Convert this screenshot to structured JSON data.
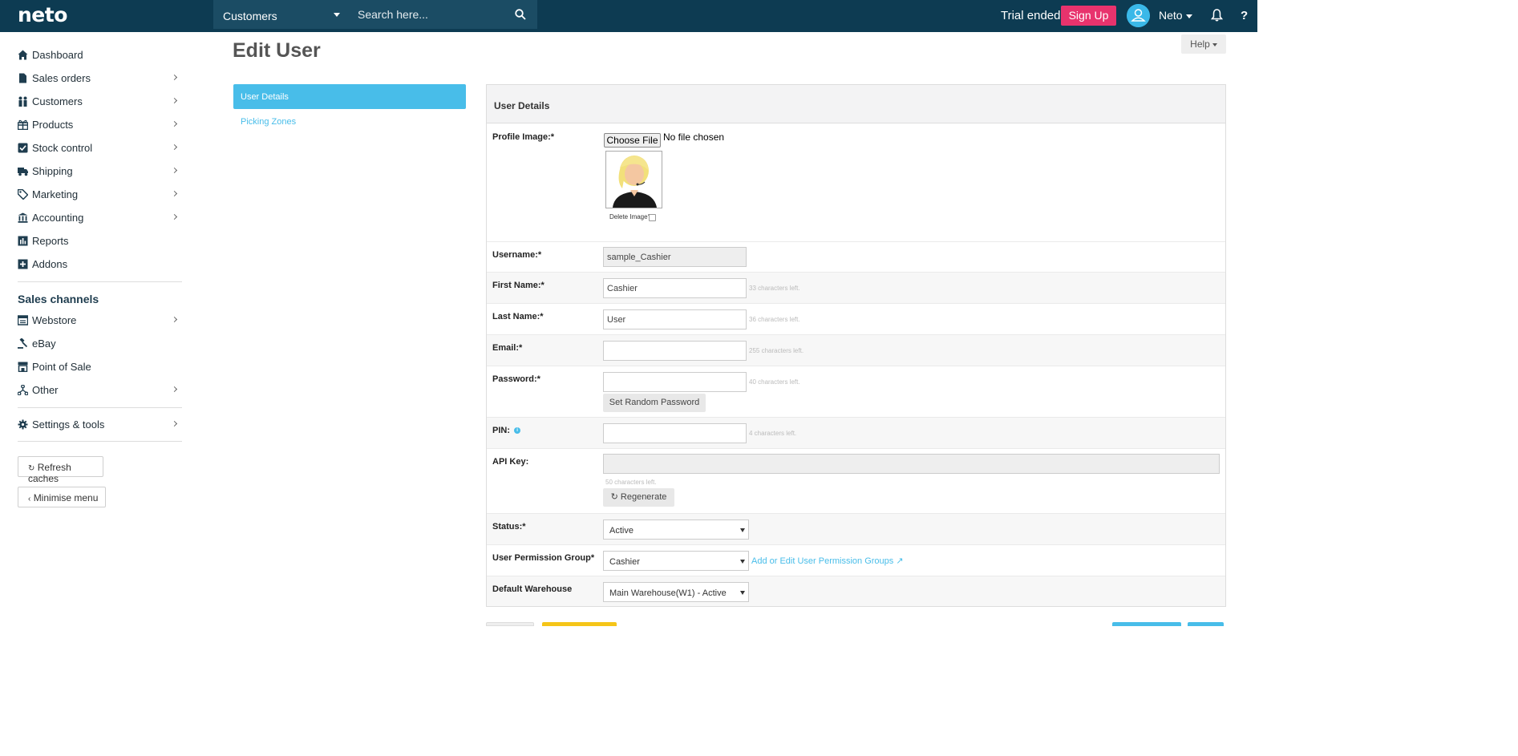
{
  "topbar": {
    "logo": "neto",
    "search_scope": "Customers",
    "search_placeholder": "Search here...",
    "trial_text": "Trial ended.",
    "signup_label": "Sign Up",
    "user_name": "Neto"
  },
  "sidebar": {
    "items": [
      {
        "label": "Dashboard",
        "icon": "home-icon"
      },
      {
        "label": "Sales orders",
        "icon": "document-icon"
      },
      {
        "label": "Customers",
        "icon": "people-icon"
      },
      {
        "label": "Products",
        "icon": "gift-icon"
      },
      {
        "label": "Stock control",
        "icon": "check-square-icon"
      },
      {
        "label": "Shipping",
        "icon": "truck-icon"
      },
      {
        "label": "Marketing",
        "icon": "tag-icon"
      },
      {
        "label": "Accounting",
        "icon": "bank-icon"
      },
      {
        "label": "Reports",
        "icon": "bar-chart-icon"
      },
      {
        "label": "Addons",
        "icon": "plus-square-icon"
      }
    ],
    "channels_heading": "Sales channels",
    "channels": [
      {
        "label": "Webstore",
        "icon": "webstore-icon"
      },
      {
        "label": "eBay",
        "icon": "gavel-icon"
      },
      {
        "label": "Point of Sale",
        "icon": "store-icon"
      },
      {
        "label": "Other",
        "icon": "fork-icon"
      }
    ],
    "settings_label": "Settings & tools",
    "refresh_label": "Refresh caches",
    "minimise_label": "Minimise menu"
  },
  "page": {
    "title": "Edit User",
    "help_label": "Help",
    "subnav": {
      "active": "User Details",
      "link": "Picking Zones"
    }
  },
  "panel": {
    "heading": "User Details",
    "profile_label": "Profile Image:*",
    "choose_file_label": "Choose File",
    "no_file_text": "No file chosen",
    "delete_image_label": "Delete Image?",
    "username_label": "Username:*",
    "username_value": "sample_Cashier",
    "firstname_label": "First Name:*",
    "firstname_value": "Cashier",
    "firstname_hint": "33 characters left.",
    "lastname_label": "Last Name:*",
    "lastname_value": "User",
    "lastname_hint": "36 characters left.",
    "email_label": "Email:*",
    "email_value": "",
    "email_hint": "255 characters left.",
    "password_label": "Password:*",
    "password_value": "",
    "password_hint": "40 characters left.",
    "random_password_label": "Set Random Password",
    "pin_label": "PIN:",
    "pin_value": "",
    "pin_hint": "4 characters left.",
    "apikey_label": "API Key:",
    "apikey_value": "",
    "apikey_hint": "50 characters left.",
    "regenerate_label": "Regenerate",
    "status_label": "Status:*",
    "status_value": "Active",
    "permission_label": "User Permission Group*",
    "permission_value": "Cashier",
    "permission_link": "Add or Edit User Permission Groups",
    "warehouse_label": "Default Warehouse",
    "warehouse_value": "Main Warehouse(W1) - Active"
  },
  "colors": {
    "topbar": "#0d3b52",
    "accent": "#48bde9",
    "signup": "#e8336d",
    "yellow_button": "#f5c518"
  }
}
